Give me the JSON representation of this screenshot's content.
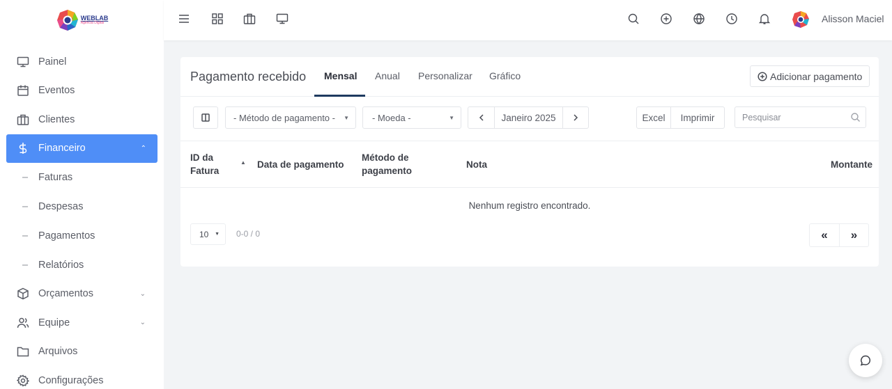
{
  "brand": {
    "name": "WEBLAB",
    "tagline": "Agência Digital"
  },
  "sidebar": {
    "items": [
      {
        "label": "Painel",
        "icon": "monitor-icon"
      },
      {
        "label": "Eventos",
        "icon": "calendar-icon"
      },
      {
        "label": "Clientes",
        "icon": "briefcase-icon"
      },
      {
        "label": "Financeiro",
        "icon": "dollar-icon",
        "active": true,
        "expanded": true
      },
      {
        "label": "Orçamentos",
        "icon": "box-icon"
      },
      {
        "label": "Equipe",
        "icon": "users-icon"
      },
      {
        "label": "Arquivos",
        "icon": "folder-icon"
      },
      {
        "label": "Configurações",
        "icon": "gear-icon"
      }
    ],
    "sub_items": [
      "Faturas",
      "Despesas",
      "Pagamentos",
      "Relatórios"
    ],
    "dash": "–"
  },
  "topbar": {
    "user_name": "Alisson Maciel"
  },
  "card": {
    "title": "Pagamento recebido",
    "tabs": [
      "Mensal",
      "Anual",
      "Personalizar",
      "Gráfico"
    ],
    "active_tab": "Mensal",
    "add_button": "Adicionar pagamento"
  },
  "filters": {
    "payment_method": "- Método de pagamento -",
    "currency": "- Moeda -",
    "period": "Janeiro 2025",
    "excel": "Excel",
    "print": "Imprimir",
    "search_placeholder": "Pesquisar"
  },
  "table": {
    "columns": [
      "ID da Fatura",
      "Data de pagamento",
      "Método de pagamento",
      "Nota",
      "Montante"
    ],
    "id_col": [
      "ID da",
      "Fatura"
    ],
    "method_col": [
      "Método de",
      "pagamento"
    ],
    "empty_message": "Nenhum registro encontrado."
  },
  "pagination": {
    "page_size": "10",
    "range": "0-0 / 0",
    "first": "«",
    "last": "»"
  },
  "colors": {
    "accent": "#4f8ef7",
    "tab_underline": "#1e3a5f"
  }
}
